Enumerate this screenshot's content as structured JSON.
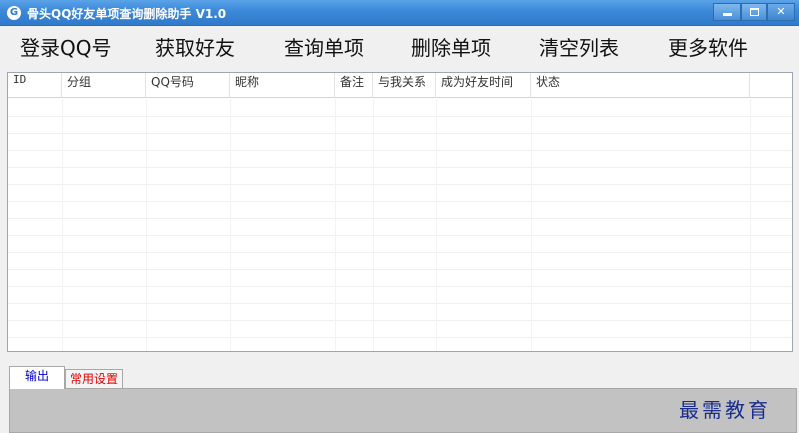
{
  "window": {
    "icon_glyph": "G",
    "title": "骨头QQ好友单项查询删除助手 V1.0",
    "close_glyph": "✕"
  },
  "menu": [
    {
      "label": "登录QQ号"
    },
    {
      "label": "获取好友"
    },
    {
      "label": "查询单项"
    },
    {
      "label": "删除单项"
    },
    {
      "label": "清空列表"
    },
    {
      "label": "更多软件"
    }
  ],
  "list": {
    "columns": [
      "ID",
      "分组",
      "QQ号码",
      "昵称",
      "备注",
      "与我关系",
      "成为好友时间",
      "状态",
      ""
    ],
    "rows": []
  },
  "tabs": [
    {
      "label": "输出",
      "color": "#0000c8",
      "active": true
    },
    {
      "label": "常用设置",
      "color": "#e00000",
      "active": false
    }
  ],
  "watermark": "最需教育"
}
